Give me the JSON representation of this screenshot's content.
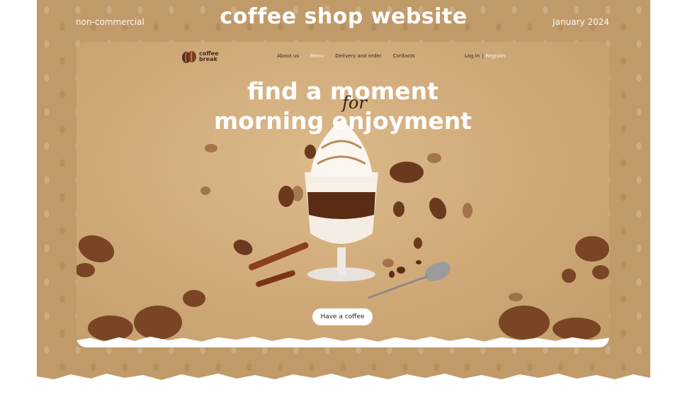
{
  "poster": {
    "left_label": "non-commercial",
    "title": "coffee shop website",
    "right_label": "January 2024"
  },
  "site": {
    "logo": {
      "line1": "coffee",
      "line2": "break"
    },
    "nav": [
      {
        "label": "About us"
      },
      {
        "label": "Menu",
        "active": true
      },
      {
        "label": "Delivery and order"
      },
      {
        "label": "Contacts"
      }
    ],
    "auth": {
      "login": "Log in",
      "separator": "|",
      "register": "Register"
    },
    "hero": {
      "line1": "find a moment",
      "script": "for",
      "line2": "morning enjoyment"
    },
    "cta": "Have a coffee"
  },
  "icons": [
    "coffee-bean-logo-icon"
  ],
  "colors": {
    "poster_bg": "#c09a68",
    "site_bg": "#cfa877",
    "bean": "#6b3a1e",
    "accent_text": "#fff4e4"
  }
}
